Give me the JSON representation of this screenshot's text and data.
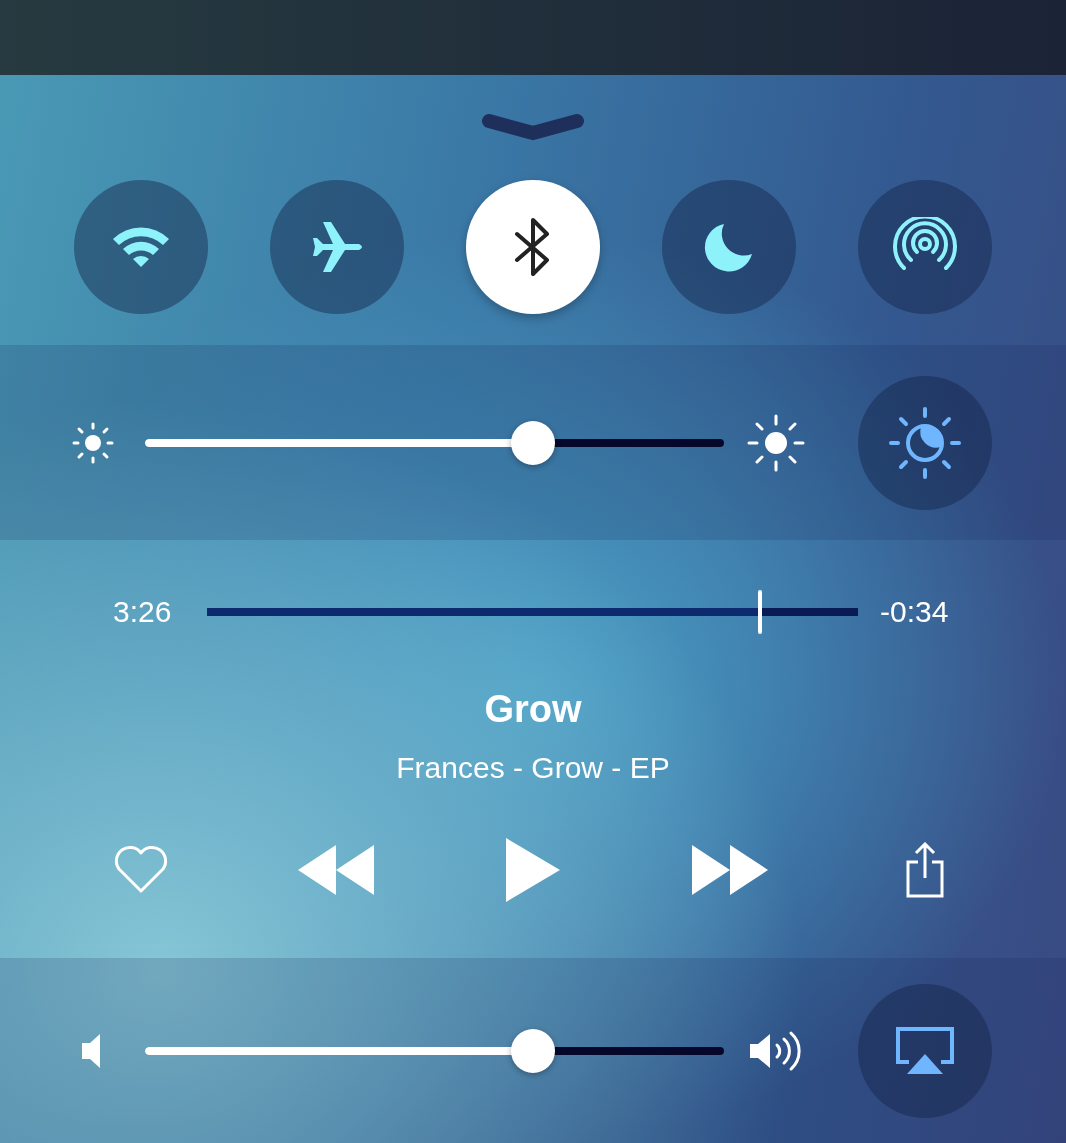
{
  "toggles": [
    {
      "kind": "wifi",
      "on": false
    },
    {
      "kind": "airplane",
      "on": false
    },
    {
      "kind": "bluetooth",
      "on": true
    },
    {
      "kind": "moon",
      "on": false
    },
    {
      "kind": "airdrop",
      "on": false
    }
  ],
  "brightness": {
    "level": 0.67
  },
  "night_shift": {
    "on": false
  },
  "now_playing": {
    "elapsed": "3:26",
    "remaining": "-0:34",
    "progress": {
      "level": 0.85
    },
    "title": "Grow",
    "subtitle": "Frances - Grow - EP",
    "liked": false
  },
  "volume": {
    "level": 0.67
  },
  "airplay": {
    "on": false
  }
}
